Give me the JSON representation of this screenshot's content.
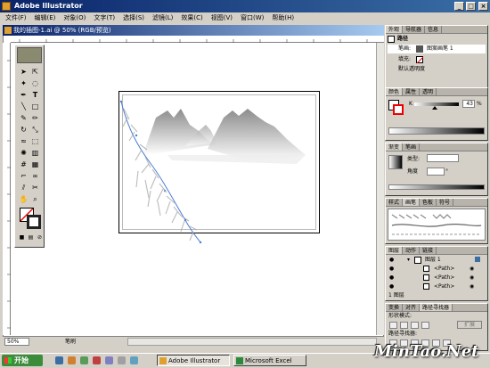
{
  "app": {
    "title": "Adobe Illustrator"
  },
  "menu": [
    "文件(F)",
    "编辑(E)",
    "对象(O)",
    "文字(T)",
    "选择(S)",
    "滤镜(L)",
    "效果(C)",
    "视图(V)",
    "窗口(W)",
    "帮助(H)"
  ],
  "document": {
    "title": "我的插图-1.ai @ 50% (RGB/预览)"
  },
  "status": {
    "zoom": "50%",
    "tool": "笔刷"
  },
  "panels": {
    "appearance": {
      "tabs": [
        "外观",
        "导航器",
        "信息"
      ],
      "item": "路径",
      "stroke_label": "笔画:",
      "stroke_value": "图案画笔 1",
      "fill_label": "填充:",
      "default_opacity": "默认透明度"
    },
    "color": {
      "tabs": [
        "颜色",
        "属性",
        "透明"
      ],
      "channel": "K",
      "value": "43",
      "unit": "%"
    },
    "gradient": {
      "tabs": [
        "渐变",
        "笔画"
      ],
      "type_label": "类型:",
      "angle_label": "角度",
      "angle_unit": "°"
    },
    "brushes": {
      "tabs": [
        "样式",
        "画笔",
        "色板",
        "符号"
      ]
    },
    "layers": {
      "tabs": [
        "图层",
        "动作",
        "链接"
      ],
      "layer_name": "图层 1",
      "paths": [
        "<Path>",
        "<Path>",
        "<Path>"
      ],
      "footer": "1 图层"
    },
    "pathfinder": {
      "tabs": [
        "变换",
        "对齐",
        "路径寻找器"
      ],
      "shape_modes": "形状模式:",
      "expand": "扩展",
      "pathfinders": "路径寻找器:"
    }
  },
  "taskbar": {
    "start": "开始",
    "tasks": [
      "Adobe Illustrator",
      "Microsoft Excel"
    ]
  },
  "watermark": "MinTao.Net",
  "colors": {
    "titlebar": "#0a246a",
    "desktop_bar": "#d4d0c8"
  }
}
